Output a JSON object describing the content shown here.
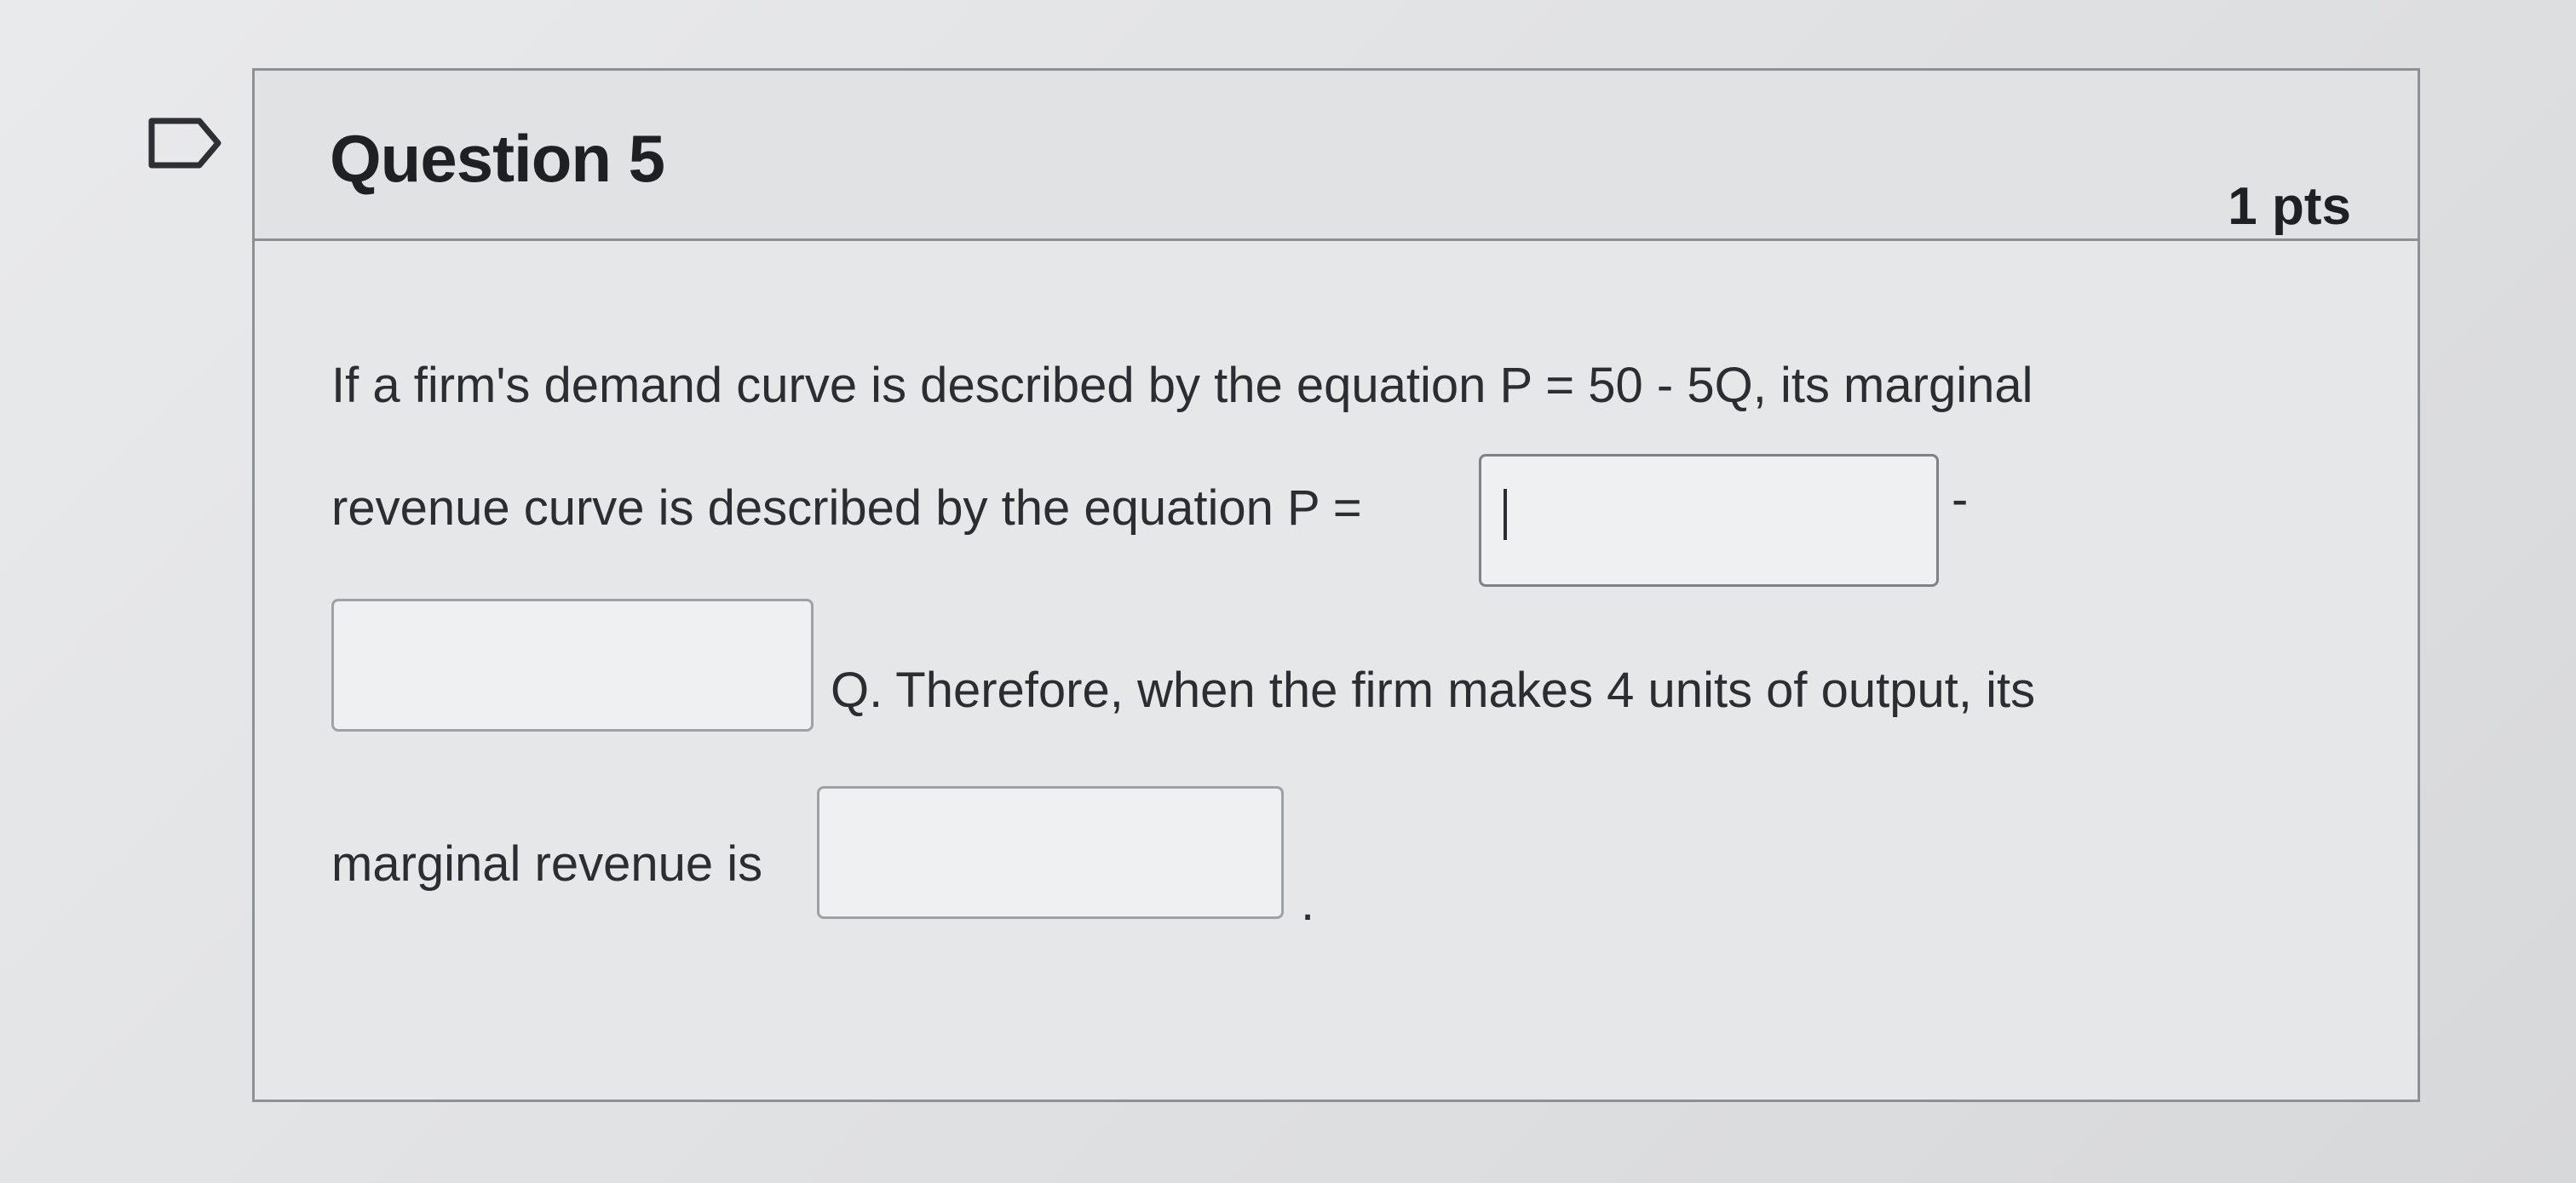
{
  "question": {
    "title": "Question 5",
    "points": "1 pts"
  },
  "prompt": {
    "line1": "If a firm's demand curve is described by the equation P = 50 - 5Q, its marginal",
    "line2": "revenue curve is described by the equation P =",
    "dash": "-",
    "line3": "Q. Therefore, when the firm makes 4 units of output, its",
    "line4": "marginal revenue is",
    "period": "."
  },
  "answers": {
    "mr_intercept": {
      "value": ""
    },
    "mr_slope": {
      "value": ""
    },
    "mr_at_4": {
      "value": ""
    }
  },
  "icons": {
    "flag": "flag-icon"
  }
}
